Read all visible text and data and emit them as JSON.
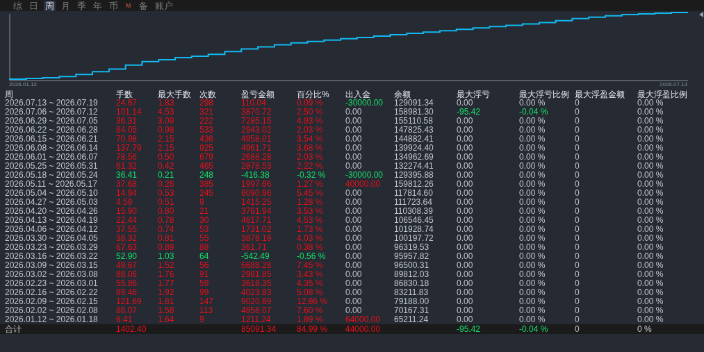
{
  "tabs": [
    {
      "label": "综",
      "kind": "text",
      "selected": false
    },
    {
      "label": "日",
      "kind": "text",
      "selected": false
    },
    {
      "label": "周",
      "kind": "text",
      "selected": true
    },
    {
      "label": "月",
      "kind": "text",
      "selected": false
    },
    {
      "label": "季",
      "kind": "text",
      "selected": false
    },
    {
      "label": "年",
      "kind": "text",
      "selected": false
    },
    {
      "label": "币",
      "kind": "text",
      "selected": false
    },
    {
      "label": "M",
      "kind": "logo",
      "selected": false
    },
    {
      "label": "备",
      "kind": "text",
      "selected": false
    },
    {
      "label": "账户",
      "kind": "text",
      "selected": false
    }
  ],
  "chart": {
    "start_label": "2026.01.12",
    "end_label": "2026.07.13"
  },
  "table": {
    "columns": [
      "周",
      "手数",
      "最大手数",
      "次数",
      "盈亏金额",
      "百分比%",
      "出入金",
      "余额",
      "最大浮亏",
      "最大浮亏比例",
      "最大浮盈金额",
      "最大浮盈比例"
    ],
    "rows": [
      {
        "week": "2026.07.13 ~ 2026.07.19",
        "trade": {
          "lots": "24.67",
          "max_lots": "1.83",
          "count": "298",
          "pnl": "110.04",
          "pct": "0.09 %",
          "color": "#e8101a"
        },
        "flow": {
          "amount": "-30000.00",
          "color": "#19e06b"
        },
        "balance": "129091.34",
        "float_loss": {
          "amount": "0.00",
          "pct": "0.00 %"
        },
        "max_float_profit": "0",
        "max_float_profit_pct": "0.00 %"
      },
      {
        "week": "2026.07.06 ~ 2026.07.12",
        "trade": {
          "lots": "101.14",
          "max_lots": "4.53",
          "count": "321",
          "pnl": "3870.72",
          "pct": "2.50 %",
          "color": "#e8101a"
        },
        "flow": {
          "amount": "0.00"
        },
        "balance": "158981.30",
        "float_loss": {
          "amount": "-95.42",
          "pct": "-0.04 %",
          "color": "#19e06b"
        },
        "max_float_profit": "0",
        "max_float_profit_pct": "0.00 %"
      },
      {
        "week": "2026.06.29 ~ 2026.07.05",
        "trade": {
          "lots": "36.31",
          "max_lots": "3.09",
          "count": "222",
          "pnl": "7285.15",
          "pct": "4.93 %",
          "color": "#e8101a"
        },
        "flow": {
          "amount": "0.00"
        },
        "balance": "155110.58",
        "float_loss": {
          "amount": "0.00",
          "pct": "0.00 %"
        },
        "max_float_profit": "0",
        "max_float_profit_pct": "0.00 %"
      },
      {
        "week": "2026.06.22 ~ 2026.06.28",
        "trade": {
          "lots": "64.05",
          "max_lots": "0.98",
          "count": "533",
          "pnl": "2943.02",
          "pct": "2.03 %",
          "color": "#e8101a"
        },
        "flow": {
          "amount": "0.00"
        },
        "balance": "147825.43",
        "float_loss": {
          "amount": "0.00",
          "pct": "0.00 %"
        },
        "max_float_profit": "0",
        "max_float_profit_pct": "0.00 %"
      },
      {
        "week": "2026.06.15 ~ 2026.06.21",
        "trade": {
          "lots": "70.98",
          "max_lots": "2.15",
          "count": "436",
          "pnl": "4958.01",
          "pct": "3.54 %",
          "color": "#e8101a"
        },
        "flow": {
          "amount": "0.00"
        },
        "balance": "144882.41",
        "float_loss": {
          "amount": "0.00",
          "pct": "0.00 %"
        },
        "max_float_profit": "0",
        "max_float_profit_pct": "0.00 %"
      },
      {
        "week": "2026.06.08 ~ 2026.06.14",
        "trade": {
          "lots": "137.79",
          "max_lots": "2.15",
          "count": "925",
          "pnl": "4961.71",
          "pct": "3.68 %",
          "color": "#e8101a"
        },
        "flow": {
          "amount": "0.00"
        },
        "balance": "139924.40",
        "float_loss": {
          "amount": "0.00",
          "pct": "0.00 %"
        },
        "max_float_profit": "0",
        "max_float_profit_pct": "0.00 %"
      },
      {
        "week": "2026.06.01 ~ 2026.06.07",
        "trade": {
          "lots": "78.56",
          "max_lots": "0.50",
          "count": "679",
          "pnl": "2688.28",
          "pct": "2.03 %",
          "color": "#e8101a"
        },
        "flow": {
          "amount": "0.00"
        },
        "balance": "134962.69",
        "float_loss": {
          "amount": "0.00",
          "pct": "0.00 %"
        },
        "max_float_profit": "0",
        "max_float_profit_pct": "0.00 %"
      },
      {
        "week": "2026.05.25 ~ 2026.05.31",
        "trade": {
          "lots": "61.32",
          "max_lots": "0.42",
          "count": "465",
          "pnl": "2878.53",
          "pct": "2.22 %",
          "color": "#e8101a"
        },
        "flow": {
          "amount": "0.00"
        },
        "balance": "132274.41",
        "float_loss": {
          "amount": "0.00",
          "pct": "0.00 %"
        },
        "max_float_profit": "0",
        "max_float_profit_pct": "0.00 %"
      },
      {
        "week": "2026.05.18 ~ 2026.05.24",
        "trade": {
          "lots": "36.41",
          "max_lots": "0.21",
          "count": "248",
          "pnl": "-416.38",
          "pct": "-0.32 %",
          "color": "#19e06b"
        },
        "flow": {
          "amount": "-30000.00",
          "color": "#19e06b"
        },
        "balance": "129395.88",
        "float_loss": {
          "amount": "0.00",
          "pct": "0.00 %"
        },
        "max_float_profit": "0",
        "max_float_profit_pct": "0.00 %"
      },
      {
        "week": "2026.05.11 ~ 2026.05.17",
        "trade": {
          "lots": "37.68",
          "max_lots": "0.26",
          "count": "385",
          "pnl": "1997.66",
          "pct": "1.27 %",
          "color": "#e8101a"
        },
        "flow": {
          "amount": "40000.00",
          "color": "#e8101a"
        },
        "balance": "159812.26",
        "float_loss": {
          "amount": "0.00",
          "pct": "0.00 %"
        },
        "max_float_profit": "0",
        "max_float_profit_pct": "0.00 %"
      },
      {
        "week": "2026.05.04 ~ 2026.05.10",
        "trade": {
          "lots": "14.94",
          "max_lots": "0.53",
          "count": "245",
          "pnl": "6090.96",
          "pct": "5.45 %",
          "color": "#e8101a"
        },
        "flow": {
          "amount": "0.00"
        },
        "balance": "117814.60",
        "float_loss": {
          "amount": "0.00",
          "pct": "0.00 %"
        },
        "max_float_profit": "0",
        "max_float_profit_pct": "0.00 %"
      },
      {
        "week": "2026.04.27 ~ 2026.05.03",
        "trade": {
          "lots": "4.59",
          "max_lots": "0.51",
          "count": "9",
          "pnl": "1415.25",
          "pct": "1.28 %",
          "color": "#e8101a"
        },
        "flow": {
          "amount": "0.00"
        },
        "balance": "111723.64",
        "float_loss": {
          "amount": "0.00",
          "pct": "0.00 %"
        },
        "max_float_profit": "0",
        "max_float_profit_pct": "0.00 %"
      },
      {
        "week": "2026.04.20 ~ 2026.04.26",
        "trade": {
          "lots": "15.90",
          "max_lots": "0.80",
          "count": "21",
          "pnl": "3761.94",
          "pct": "3.53 %",
          "color": "#e8101a"
        },
        "flow": {
          "amount": "0.00"
        },
        "balance": "110308.39",
        "float_loss": {
          "amount": "0.00",
          "pct": "0.00 %"
        },
        "max_float_profit": "0",
        "max_float_profit_pct": "0.00 %"
      },
      {
        "week": "2026.04.13 ~ 2026.04.19",
        "trade": {
          "lots": "22.44",
          "max_lots": "0.78",
          "count": "30",
          "pnl": "4617.71",
          "pct": "4.53 %",
          "color": "#e8101a"
        },
        "flow": {
          "amount": "0.00"
        },
        "balance": "106546.45",
        "float_loss": {
          "amount": "0.00",
          "pct": "0.00 %"
        },
        "max_float_profit": "0",
        "max_float_profit_pct": "0.00 %"
      },
      {
        "week": "2026.04.06 ~ 2026.04.12",
        "trade": {
          "lots": "37.55",
          "max_lots": "0.74",
          "count": "53",
          "pnl": "1731.02",
          "pct": "1.73 %",
          "color": "#e8101a"
        },
        "flow": {
          "amount": "0.00"
        },
        "balance": "101928.74",
        "float_loss": {
          "amount": "0.00",
          "pct": "0.00 %"
        },
        "max_float_profit": "0",
        "max_float_profit_pct": "0.00 %"
      },
      {
        "week": "2026.03.30 ~ 2026.04.05",
        "trade": {
          "lots": "38.32",
          "max_lots": "0.81",
          "count": "55",
          "pnl": "3878.19",
          "pct": "4.03 %",
          "color": "#e8101a"
        },
        "flow": {
          "amount": "0.00"
        },
        "balance": "100197.72",
        "float_loss": {
          "amount": "0.00",
          "pct": "0.00 %"
        },
        "max_float_profit": "0",
        "max_float_profit_pct": "0.00 %"
      },
      {
        "week": "2026.03.23 ~ 2026.03.29",
        "trade": {
          "lots": "67.63",
          "max_lots": "0.89",
          "count": "88",
          "pnl": "361.71",
          "pct": "0.38 %",
          "color": "#e8101a"
        },
        "flow": {
          "amount": "0.00"
        },
        "balance": "96319.53",
        "float_loss": {
          "amount": "0.00",
          "pct": "0.00 %"
        },
        "max_float_profit": "0",
        "max_float_profit_pct": "0.00 %"
      },
      {
        "week": "2026.03.16 ~ 2026.03.22",
        "trade": {
          "lots": "52.90",
          "max_lots": "1.03",
          "count": "64",
          "pnl": "-542.49",
          "pct": "-0.56 %",
          "color": "#19e06b"
        },
        "flow": {
          "amount": "0.00"
        },
        "balance": "95957.82",
        "float_loss": {
          "amount": "0.00",
          "pct": "0.00 %"
        },
        "max_float_profit": "0",
        "max_float_profit_pct": "0.00 %"
      },
      {
        "week": "2026.03.09 ~ 2026.03.15",
        "trade": {
          "lots": "49.67",
          "max_lots": "1.52",
          "count": "56",
          "pnl": "6688.28",
          "pct": "7.45 %",
          "color": "#e8101a"
        },
        "flow": {
          "amount": "0.00"
        },
        "balance": "96500.31",
        "float_loss": {
          "amount": "0.00",
          "pct": "0.00 %"
        },
        "max_float_profit": "0",
        "max_float_profit_pct": "0.00 %"
      },
      {
        "week": "2026.03.02 ~ 2026.03.08",
        "trade": {
          "lots": "88.06",
          "max_lots": "1.76",
          "count": "91",
          "pnl": "2981.85",
          "pct": "3.43 %",
          "color": "#e8101a"
        },
        "flow": {
          "amount": "0.00"
        },
        "balance": "89812.03",
        "float_loss": {
          "amount": "0.00",
          "pct": "0.00 %"
        },
        "max_float_profit": "0",
        "max_float_profit_pct": "0.00 %"
      },
      {
        "week": "2026.02.23 ~ 2026.03.01",
        "trade": {
          "lots": "55.86",
          "max_lots": "1.77",
          "count": "59",
          "pnl": "3618.35",
          "pct": "4.35 %",
          "color": "#e8101a"
        },
        "flow": {
          "amount": "0.00"
        },
        "balance": "86830.18",
        "float_loss": {
          "amount": "0.00",
          "pct": "0.00 %"
        },
        "max_float_profit": "0",
        "max_float_profit_pct": "0.00 %"
      },
      {
        "week": "2026.02.16 ~ 2026.02.22",
        "trade": {
          "lots": "89.46",
          "max_lots": "1.92",
          "count": "99",
          "pnl": "4023.83",
          "pct": "5.08 %",
          "color": "#e8101a"
        },
        "flow": {
          "amount": "0.00"
        },
        "balance": "83211.83",
        "float_loss": {
          "amount": "0.00",
          "pct": "0.00 %"
        },
        "max_float_profit": "0",
        "max_float_profit_pct": "0.00 %"
      },
      {
        "week": "2026.02.09 ~ 2026.02.15",
        "trade": {
          "lots": "121.69",
          "max_lots": "1.81",
          "count": "147",
          "pnl": "9020.69",
          "pct": "12.86 %",
          "color": "#e8101a"
        },
        "flow": {
          "amount": "0.00"
        },
        "balance": "79188.00",
        "float_loss": {
          "amount": "0.00",
          "pct": "0.00 %"
        },
        "max_float_profit": "0",
        "max_float_profit_pct": "0.00 %"
      },
      {
        "week": "2026.02.02 ~ 2026.02.08",
        "trade": {
          "lots": "88.07",
          "max_lots": "1.58",
          "count": "113",
          "pnl": "4956.07",
          "pct": "7.60 %",
          "color": "#e8101a"
        },
        "flow": {
          "amount": "0.00"
        },
        "balance": "70167.31",
        "float_loss": {
          "amount": "0.00",
          "pct": "0.00 %"
        },
        "max_float_profit": "0",
        "max_float_profit_pct": "0.00 %"
      },
      {
        "week": "2026.01.12 ~ 2026.01.18",
        "trade": {
          "lots": "6.41",
          "max_lots": "1.64",
          "count": "9",
          "pnl": "1211.24",
          "pct": "1.89 %",
          "color": "#e8101a"
        },
        "flow": {
          "amount": "64000.00",
          "color": "#e8101a"
        },
        "balance": "65211.24",
        "float_loss": {
          "amount": "0.00",
          "pct": "0.00 %"
        },
        "max_float_profit": "0",
        "max_float_profit_pct": "0.00 %"
      }
    ],
    "total": {
      "label": "合计",
      "trade": {
        "lots": "1402.40",
        "pnl": "85091.34",
        "pct": "84.99 %",
        "color": "#e8101a"
      },
      "flow": {
        "amount": "44000.00",
        "color": "#e8101a"
      },
      "float_loss": {
        "amount": "-95.42",
        "pct": "-0.04 %",
        "color": "#19e06b"
      },
      "max_float_profit": "0",
      "max_float_profit_pct": "0 %"
    }
  }
}
